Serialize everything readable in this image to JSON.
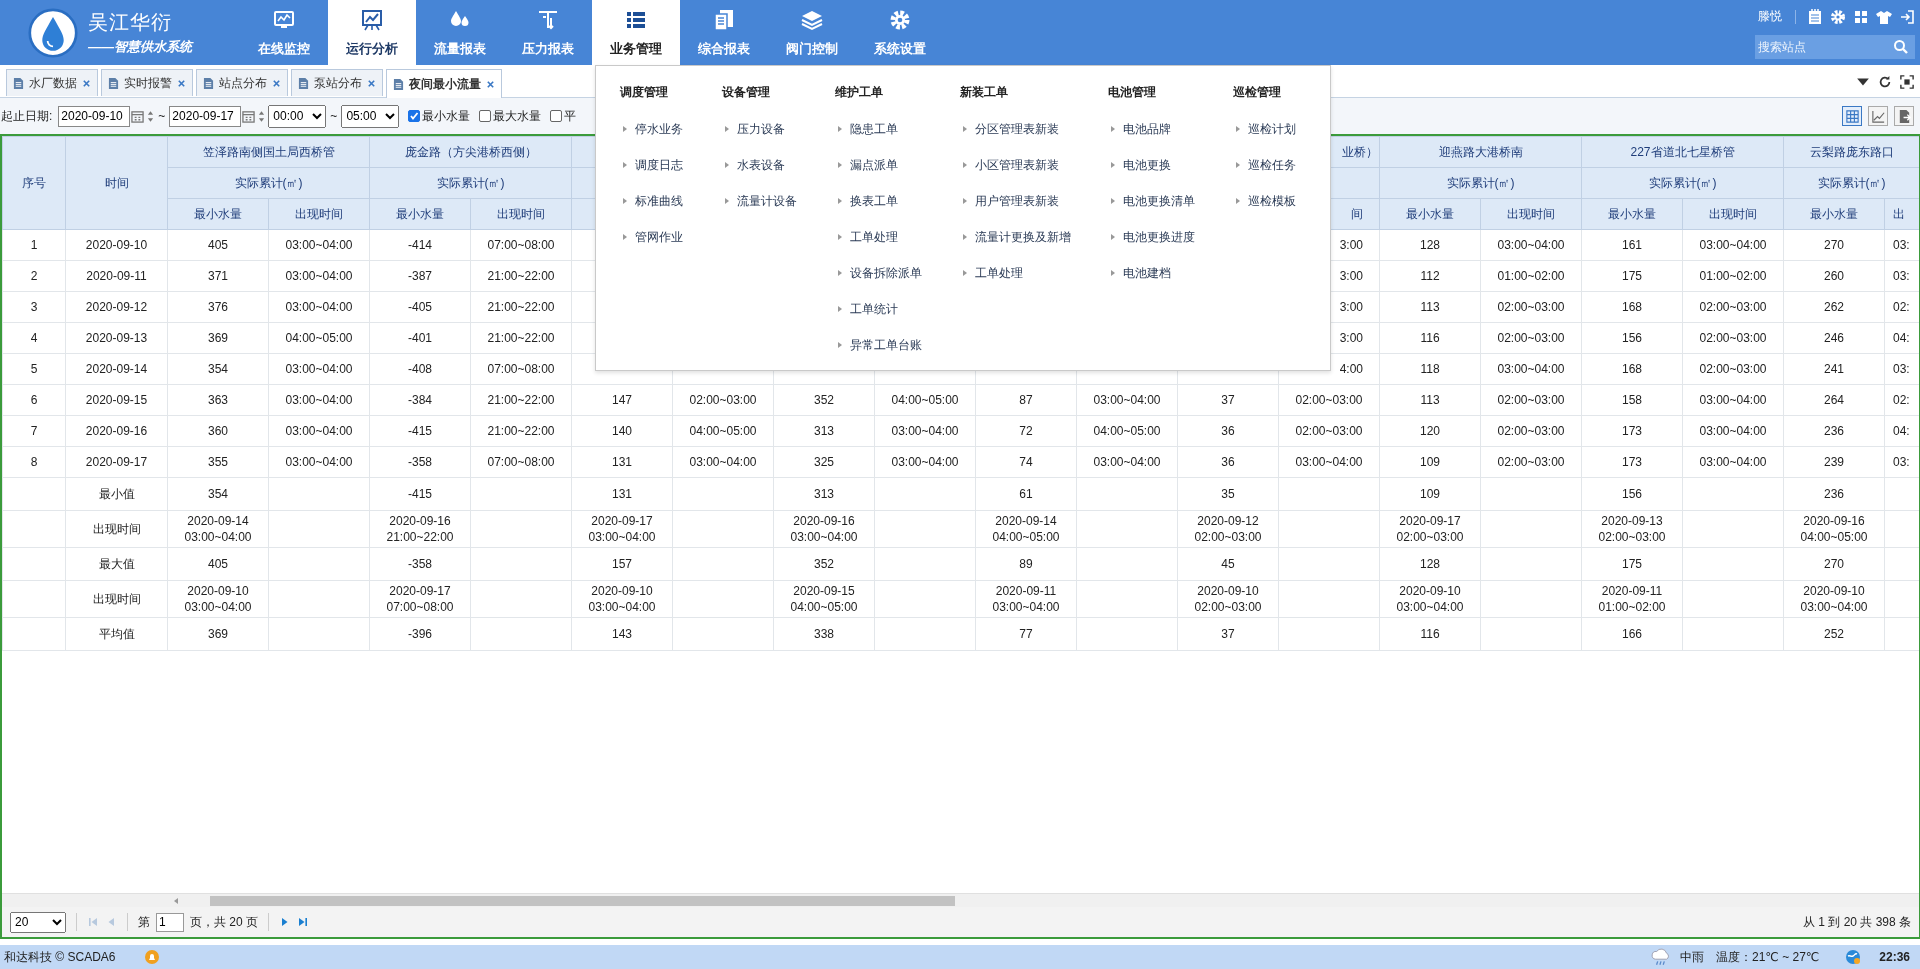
{
  "brand": {
    "name": "吴江华衍",
    "slogan": "——智慧供水系统"
  },
  "nav": {
    "items": [
      {
        "label": "在线监控",
        "selected": false,
        "expanded": false
      },
      {
        "label": "运行分析",
        "selected": true,
        "expanded": false
      },
      {
        "label": "流量报表",
        "selected": false,
        "expanded": false
      },
      {
        "label": "压力报表",
        "selected": false,
        "expanded": false
      },
      {
        "label": "业务管理",
        "selected": false,
        "expanded": true
      },
      {
        "label": "综合报表",
        "selected": false,
        "expanded": false
      },
      {
        "label": "阀门控制",
        "selected": false,
        "expanded": false
      },
      {
        "label": "系统设置",
        "selected": false,
        "expanded": false
      }
    ]
  },
  "user": {
    "name": "滕悦"
  },
  "search": {
    "placeholder": "搜索站点"
  },
  "tabs": [
    {
      "label": "水厂数据",
      "selected": false
    },
    {
      "label": "实时报警",
      "selected": false
    },
    {
      "label": "站点分布",
      "selected": false
    },
    {
      "label": "泵站分布",
      "selected": false
    },
    {
      "label": "夜间最小流量",
      "selected": true
    }
  ],
  "filter": {
    "label": "起止日期:",
    "start_date": "2020-09-10",
    "separator": "~",
    "end_date": "2020-09-17",
    "start_time": "00:00",
    "separator_2": "~",
    "end_time": "05:00",
    "checks": [
      {
        "label": "最小水量",
        "checked": true
      },
      {
        "label": "最大水量",
        "checked": false
      },
      {
        "label": "平",
        "checked": false
      }
    ]
  },
  "views": [
    {
      "selected": true
    },
    {
      "selected": false
    },
    {
      "selected": false
    }
  ],
  "table": {
    "col_no": "序号",
    "col_time": "时间",
    "sites": [
      {
        "name": "笠泽路南侧国土局西桥管",
        "unit": "实际累计(㎡)",
        "min_header": "最小水量",
        "time_header": "出现时间"
      },
      {
        "name": "庞金路（方尖港桥西侧）",
        "unit": "实际累计(㎡)",
        "min_header": "最小水量",
        "time_header": "出现时间"
      },
      {
        "name": "业桥）",
        "time_header": "间"
      },
      {
        "name": "迎燕路大港桥南",
        "unit": "实际累计(㎡)",
        "min_header": "最小水量",
        "time_header": "出现时间"
      },
      {
        "name": "227省道北七星桥管",
        "unit": "实际累计(㎡)",
        "min_header": "最小水量",
        "time_header": "出现时间"
      },
      {
        "name": "云梨路庞东路口",
        "unit": "实际累计(㎡)",
        "min_header": "最小水量",
        "time_header": "出"
      }
    ],
    "rows": [
      {
        "no": "1",
        "date": "2020-09-10",
        "cells": [
          [
            "405",
            "03:00~04:00"
          ],
          [
            "-414",
            "07:00~08:00"
          ],
          [
            null,
            null
          ],
          [
            null,
            null
          ],
          [
            null,
            null
          ],
          [
            null,
            "3:00"
          ],
          [
            "128",
            "03:00~04:00"
          ],
          [
            "161",
            "03:00~04:00"
          ],
          [
            "270",
            "03:"
          ]
        ]
      },
      {
        "no": "2",
        "date": "2020-09-11",
        "cells": [
          [
            "371",
            "03:00~04:00"
          ],
          [
            "-387",
            "21:00~22:00"
          ],
          [
            null,
            null
          ],
          [
            null,
            null
          ],
          [
            null,
            null
          ],
          [
            null,
            "3:00"
          ],
          [
            "112",
            "01:00~02:00"
          ],
          [
            "175",
            "01:00~02:00"
          ],
          [
            "260",
            "03:"
          ]
        ]
      },
      {
        "no": "3",
        "date": "2020-09-12",
        "cells": [
          [
            "376",
            "03:00~04:00"
          ],
          [
            "-405",
            "21:00~22:00"
          ],
          [
            null,
            null
          ],
          [
            null,
            null
          ],
          [
            null,
            null
          ],
          [
            null,
            "3:00"
          ],
          [
            "113",
            "02:00~03:00"
          ],
          [
            "168",
            "02:00~03:00"
          ],
          [
            "262",
            "02:"
          ]
        ]
      },
      {
        "no": "4",
        "date": "2020-09-13",
        "cells": [
          [
            "369",
            "04:00~05:00"
          ],
          [
            "-401",
            "21:00~22:00"
          ],
          [
            null,
            null
          ],
          [
            null,
            null
          ],
          [
            null,
            null
          ],
          [
            null,
            "3:00"
          ],
          [
            "116",
            "02:00~03:00"
          ],
          [
            "156",
            "02:00~03:00"
          ],
          [
            "246",
            "04:"
          ]
        ]
      },
      {
        "no": "5",
        "date": "2020-09-14",
        "cells": [
          [
            "354",
            "03:00~04:00"
          ],
          [
            "-408",
            "07:00~08:00"
          ],
          [
            null,
            null
          ],
          [
            null,
            null
          ],
          [
            null,
            null
          ],
          [
            null,
            "4:00"
          ],
          [
            "118",
            "03:00~04:00"
          ],
          [
            "168",
            "02:00~03:00"
          ],
          [
            "241",
            "03:"
          ]
        ]
      },
      {
        "no": "6",
        "date": "2020-09-15",
        "cells": [
          [
            "363",
            "03:00~04:00"
          ],
          [
            "-384",
            "21:00~22:00"
          ],
          [
            "147",
            "02:00~03:00"
          ],
          [
            "352",
            "04:00~05:00"
          ],
          [
            "87",
            "03:00~04:00"
          ],
          [
            "37",
            "02:00~03:00"
          ],
          [
            "113",
            "02:00~03:00"
          ],
          [
            "158",
            "03:00~04:00"
          ],
          [
            "264",
            "02:"
          ]
        ]
      },
      {
        "no": "7",
        "date": "2020-09-16",
        "cells": [
          [
            "360",
            "03:00~04:00"
          ],
          [
            "-415",
            "21:00~22:00"
          ],
          [
            "140",
            "04:00~05:00"
          ],
          [
            "313",
            "03:00~04:00"
          ],
          [
            "72",
            "04:00~05:00"
          ],
          [
            "36",
            "02:00~03:00"
          ],
          [
            "120",
            "02:00~03:00"
          ],
          [
            "173",
            "03:00~04:00"
          ],
          [
            "236",
            "04:"
          ]
        ]
      },
      {
        "no": "8",
        "date": "2020-09-17",
        "cells": [
          [
            "355",
            "03:00~04:00"
          ],
          [
            "-358",
            "07:00~08:00"
          ],
          [
            "131",
            "03:00~04:00"
          ],
          [
            "325",
            "03:00~04:00"
          ],
          [
            "74",
            "03:00~04:00"
          ],
          [
            "36",
            "03:00~04:00"
          ],
          [
            "109",
            "02:00~03:00"
          ],
          [
            "173",
            "03:00~04:00"
          ],
          [
            "239",
            "03:"
          ]
        ]
      }
    ],
    "summary": [
      {
        "label": "最小值",
        "values": [
          "354",
          "-415",
          "131",
          "313",
          "61",
          "35",
          "109",
          "156",
          "236"
        ]
      },
      {
        "label": "出现时间",
        "values": [
          "2020-09-14\n03:00~04:00",
          "2020-09-16\n21:00~22:00",
          "2020-09-17\n03:00~04:00",
          "2020-09-16\n03:00~04:00",
          "2020-09-14\n04:00~05:00",
          "2020-09-12\n02:00~03:00",
          "2020-09-17\n02:00~03:00",
          "2020-09-13\n02:00~03:00",
          "2020-09-16\n04:00~05:00"
        ]
      },
      {
        "label": "最大值",
        "values": [
          "405",
          "-358",
          "157",
          "352",
          "89",
          "45",
          "128",
          "175",
          "270"
        ]
      },
      {
        "label": "出现时间",
        "values": [
          "2020-09-10\n03:00~04:00",
          "2020-09-17\n07:00~08:00",
          "2020-09-10\n03:00~04:00",
          "2020-09-15\n04:00~05:00",
          "2020-09-11\n03:00~04:00",
          "2020-09-10\n02:00~03:00",
          "2020-09-10\n03:00~04:00",
          "2020-09-11\n01:00~02:00",
          "2020-09-10\n03:00~04:00"
        ]
      },
      {
        "label": "平均值",
        "values": [
          "369",
          "-396",
          "143",
          "338",
          "77",
          "37",
          "116",
          "166",
          "252"
        ]
      }
    ]
  },
  "pager": {
    "page_size": "20",
    "first_disabled": true,
    "prev_disabled": true,
    "next_disabled": false,
    "last_disabled": false,
    "page_prefix": "第",
    "page": "1",
    "page_suffix": "页，共 20 页",
    "summary": "从 1 到 20 共 398 条"
  },
  "status_bar": {
    "company": "和达科技 © SCADA6",
    "weather": "中雨",
    "temperature": "温度：21℃ ~ 27℃",
    "time": "22:36"
  },
  "menu": {
    "columns": [
      {
        "title": "调度管理",
        "items": [
          "停水业务",
          "调度日志",
          "标准曲线",
          "管网作业"
        ]
      },
      {
        "title": "设备管理",
        "items": [
          "压力设备",
          "水表设备",
          "流量计设备"
        ]
      },
      {
        "title": "维护工单",
        "items": [
          "隐患工单",
          "漏点派单",
          "换表工单",
          "工单处理",
          "设备拆除派单",
          "工单统计",
          "异常工单台账"
        ]
      },
      {
        "title": "新装工单",
        "items": [
          "分区管理表新装",
          "小区管理表新装",
          "用户管理表新装",
          "流量计更换及新增",
          "工单处理"
        ]
      },
      {
        "title": "电池管理",
        "items": [
          "电池品牌",
          "电池更换",
          "电池更换清单",
          "电池更换进度",
          "电池建档"
        ]
      },
      {
        "title": "巡检管理",
        "items": [
          "巡检计划",
          "巡检任务",
          "巡检模板"
        ]
      }
    ]
  }
}
